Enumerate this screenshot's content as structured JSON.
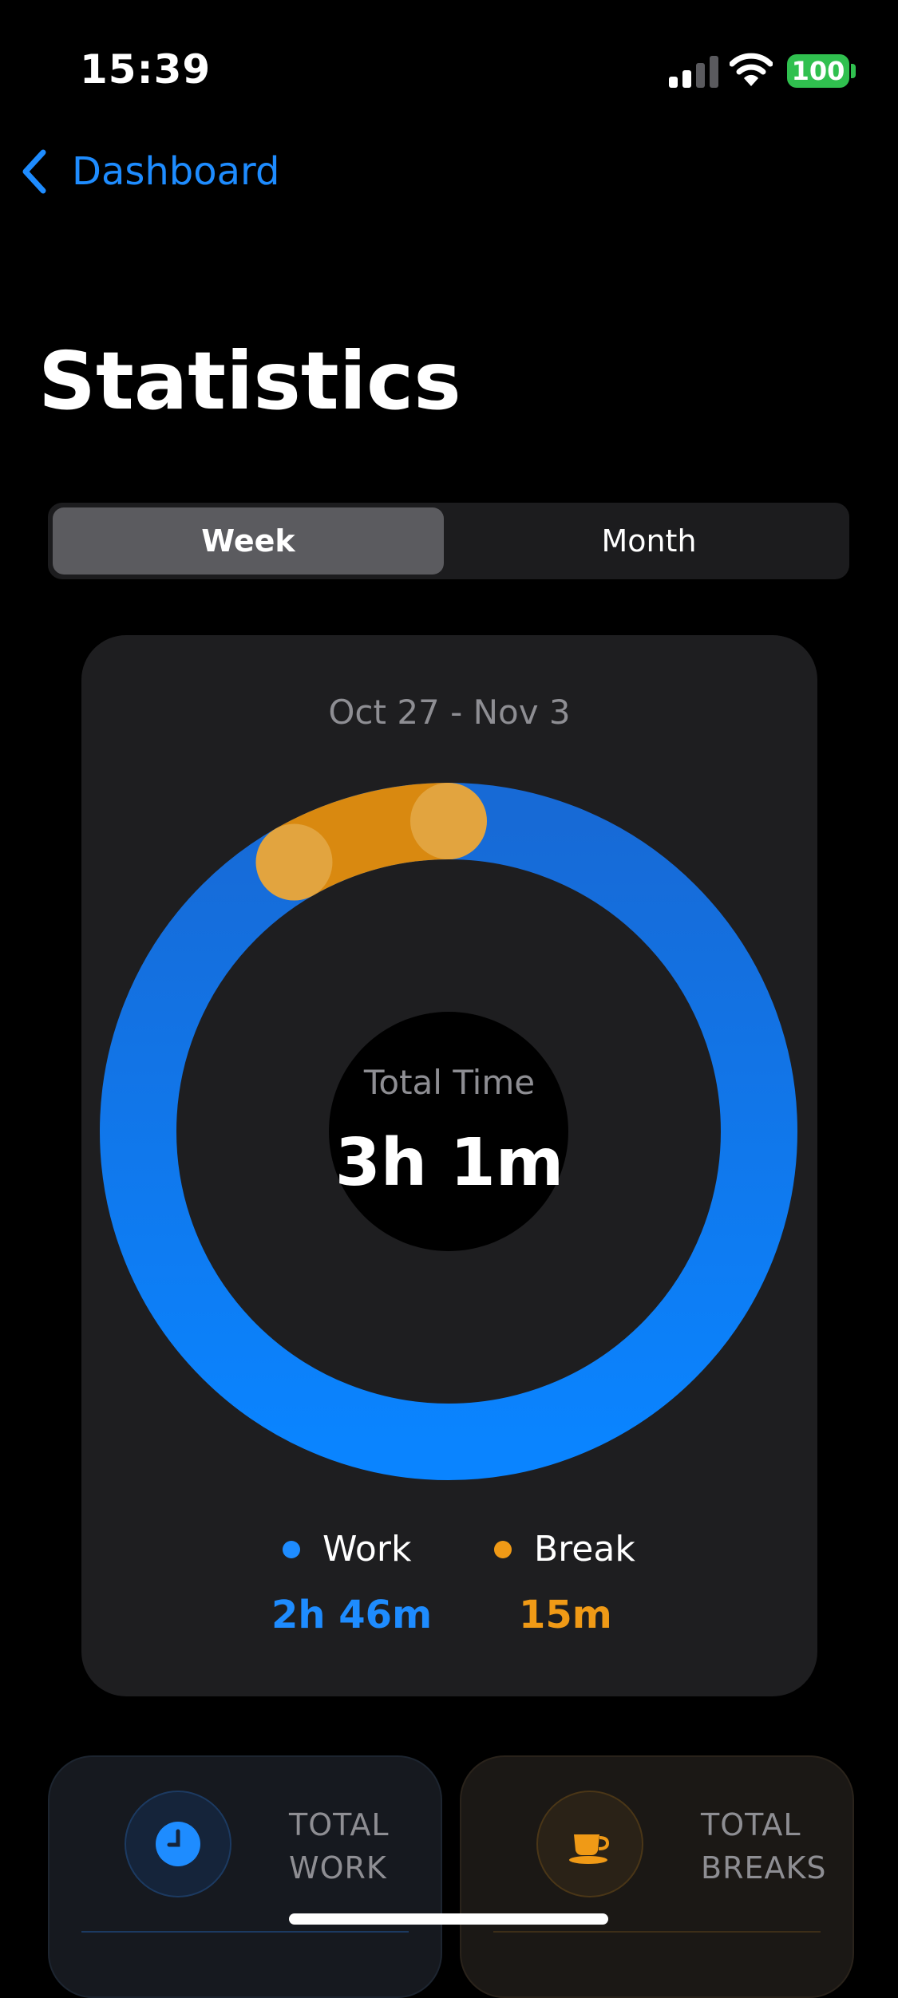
{
  "status_bar": {
    "time": "15:39",
    "battery_level": "100",
    "battery_color": "#30c04f"
  },
  "nav": {
    "back_label": "Dashboard",
    "back_icon": "chevron-left-icon"
  },
  "page": {
    "title": "Statistics"
  },
  "segmented_control": {
    "options": [
      "Week",
      "Month"
    ],
    "selected": "Week"
  },
  "summary": {
    "date_range": "Oct 27 - Nov 3",
    "center_label": "Total Time",
    "center_value": "3h 1m",
    "legend": [
      {
        "name": "Work",
        "value": "2h 46m",
        "color": "#1e8cff"
      },
      {
        "name": "Break",
        "value": "15m",
        "color": "#f09a16"
      }
    ]
  },
  "chart_data": {
    "type": "pie",
    "categories": [
      "Work",
      "Break"
    ],
    "values": [
      166,
      15
    ],
    "colors": [
      "#1e8cff",
      "#f09a16"
    ],
    "title": "",
    "center_text": "3h 1m"
  },
  "stat_cards": {
    "work": {
      "label_line1": "TOTAL",
      "label_line2": "WORK",
      "icon": "clock-icon",
      "accent": "#1e8cff"
    },
    "breaks": {
      "label_line1": "TOTAL",
      "label_line2": "BREAKS",
      "icon": "coffee-cup-icon",
      "accent": "#f09a16"
    }
  }
}
